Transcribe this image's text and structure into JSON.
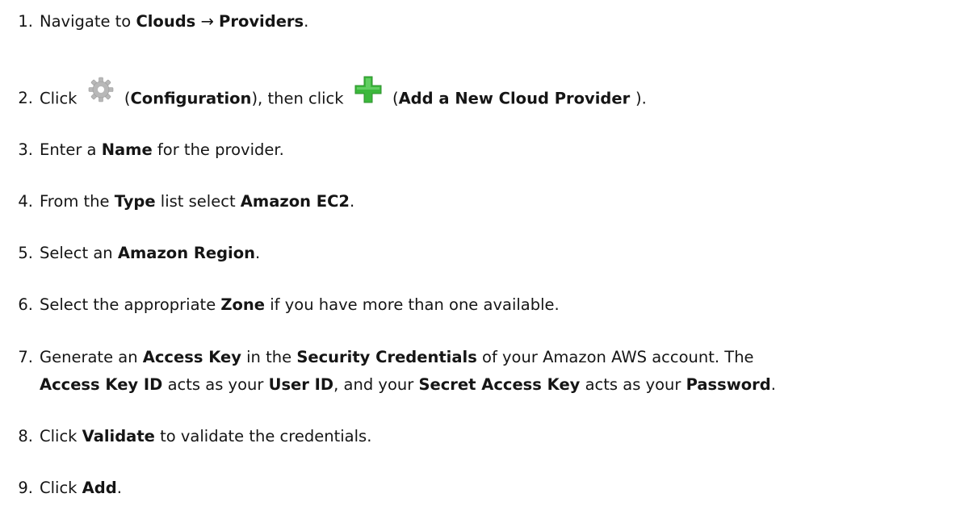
{
  "steps": [
    {
      "number": "1.",
      "parts": [
        "Navigate to ",
        "Clouds",
        " → ",
        "Providers",
        "."
      ]
    },
    {
      "number": "2.",
      "parts": [
        "Click ",
        " (",
        "Configuration",
        "), then click ",
        " (",
        "Add a New Cloud Provider ",
        ")."
      ],
      "icons": [
        "gear-icon",
        "plus-icon"
      ]
    },
    {
      "number": "3.",
      "parts": [
        "Enter a ",
        "Name",
        " for the provider."
      ]
    },
    {
      "number": "4.",
      "parts": [
        "From the ",
        "Type",
        " list select  ",
        "Amazon EC2",
        "."
      ]
    },
    {
      "number": "5.",
      "parts": [
        "Select an ",
        "Amazon Region",
        "."
      ]
    },
    {
      "number": "6.",
      "parts": [
        "Select the appropriate ",
        "Zone",
        " if you have more than one available."
      ]
    },
    {
      "number": "7.",
      "parts": [
        "Generate an ",
        "Access Key",
        " in the  ",
        "Security Credentials",
        " of your Amazon AWS account. The",
        "Access Key ID",
        " acts as your  ",
        "User ID",
        ", and your ",
        "Secret Access Key",
        " acts as your  ",
        "Password",
        "."
      ]
    },
    {
      "number": "8.",
      "parts": [
        "Click ",
        "Validate",
        " to validate the credentials."
      ]
    },
    {
      "number": "9.",
      "parts": [
        "Click ",
        "Add",
        "."
      ]
    }
  ],
  "colors": {
    "text": "#151515",
    "gear_icon": "#b8b8b8",
    "plus_icon": "#3cb83c"
  }
}
